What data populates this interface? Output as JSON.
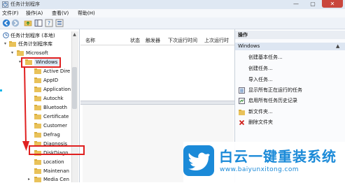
{
  "window": {
    "title": "任务计划程序",
    "minimize_glyph": "—",
    "maximize_glyph": "▢",
    "close_glyph": "✕"
  },
  "menu": [
    "文件(F)",
    "操作(A)",
    "查看(V)",
    "帮助(H)"
  ],
  "tree": {
    "root": "任务计划程序 (本地)",
    "library": "任务计划程序库",
    "microsoft": "Microsoft",
    "windows": "Windows",
    "children": [
      "Active Dire",
      "AppID",
      "Application",
      "Autochk",
      "Bluetooth",
      "Certificate",
      "Customer",
      "Defrag",
      "Diagnosis",
      "DiskDiagn",
      "Location",
      "Maintenan",
      "Media Cen"
    ]
  },
  "columns": [
    "名称",
    "状态",
    "触发器",
    "下次运行时间",
    "上次运行时"
  ],
  "actions": {
    "header": "操作",
    "section": "Windows",
    "items": [
      {
        "label": "创建基本任务...",
        "icon": "none"
      },
      {
        "label": "创建任务...",
        "icon": "none"
      },
      {
        "label": "导入任务...",
        "icon": "none"
      },
      {
        "label": "显示所有正在运行的任务",
        "icon": "run-list-icon"
      },
      {
        "label": "启用所有任务历史记录",
        "icon": "history-icon"
      },
      {
        "label": "新文件夹...",
        "icon": "new-folder-icon"
      },
      {
        "label": "删除文件夹",
        "icon": "delete-x-icon"
      }
    ]
  },
  "watermark": {
    "title": "白云一键重装系统",
    "url": "www.baiyunxitong.com"
  },
  "colors": {
    "accent": "#1b8ad8",
    "highlight": "#e02020",
    "folder": "#e9c25a"
  }
}
